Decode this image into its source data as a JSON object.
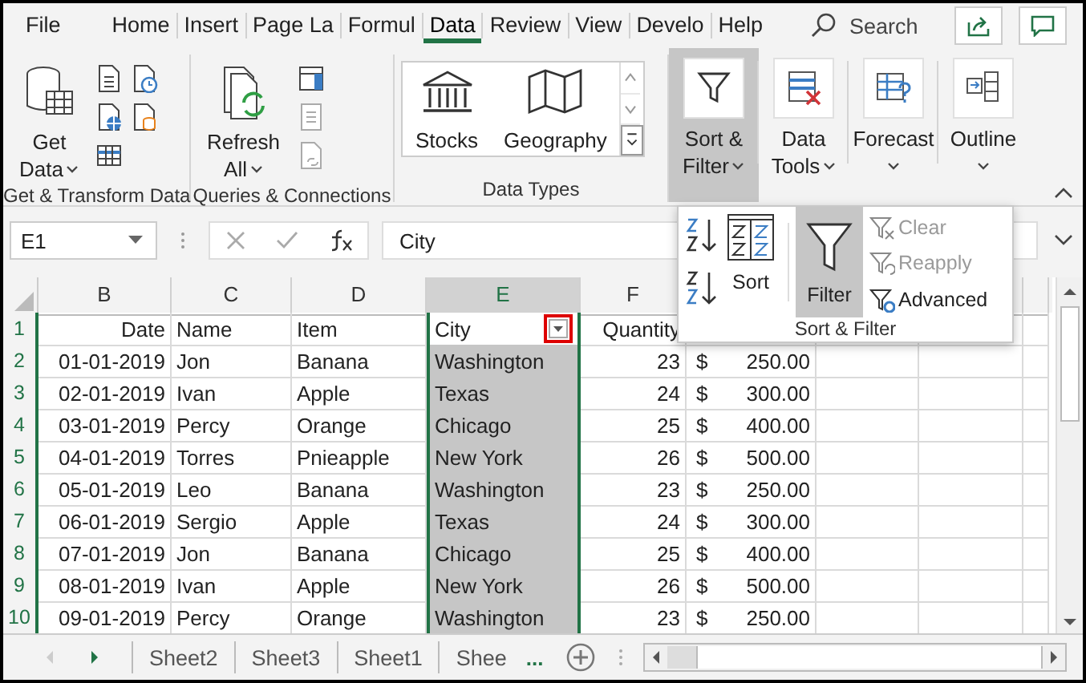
{
  "menu_tabs": [
    {
      "label": "File",
      "selected": false
    },
    {
      "label": "Home",
      "selected": false
    },
    {
      "label": "Insert",
      "selected": false
    },
    {
      "label": "Page La",
      "selected": false
    },
    {
      "label": "Formul",
      "selected": false
    },
    {
      "label": "Data",
      "selected": true
    },
    {
      "label": "Review",
      "selected": false
    },
    {
      "label": "View",
      "selected": false
    },
    {
      "label": "Develo",
      "selected": false
    },
    {
      "label": "Help",
      "selected": false
    }
  ],
  "search": {
    "placeholder": "Search"
  },
  "ribbon": {
    "groups": [
      {
        "kind": "get_data",
        "label": "Get & Transform Data",
        "button": {
          "lines": [
            "Get",
            "Data"
          ],
          "dropdown": true
        }
      },
      {
        "kind": "queries",
        "label": "Queries & Connections",
        "button": {
          "lines": [
            "Refresh",
            "All"
          ],
          "dropdown": true
        }
      },
      {
        "kind": "data_types",
        "label": "Data Types",
        "items": [
          "Stocks",
          "Geography"
        ]
      },
      {
        "kind": "filter",
        "button": {
          "lines": [
            "Sort &",
            "Filter"
          ],
          "dropdown": true,
          "selected": true
        }
      },
      {
        "kind": "data_tools",
        "button": {
          "lines": [
            "Data",
            "Tools"
          ],
          "dropdown": true,
          "selected": false
        }
      },
      {
        "kind": "forecast",
        "button": {
          "lines": [
            "Forecast"
          ],
          "dropdown": true,
          "selected": false
        }
      },
      {
        "kind": "outline",
        "button": {
          "lines": [
            "Outline"
          ],
          "dropdown": true,
          "selected": false
        }
      }
    ]
  },
  "formula_bar": {
    "name_box": "E1",
    "formula": "City"
  },
  "sheet": {
    "columns": [
      {
        "label": "B",
        "selected": false
      },
      {
        "label": "C",
        "selected": false
      },
      {
        "label": "D",
        "selected": false
      },
      {
        "label": "E",
        "selected": true
      },
      {
        "label": "F",
        "selected": false
      }
    ],
    "header_row": {
      "number": "1",
      "cells": [
        {
          "text": "Date",
          "filter_button": false
        },
        {
          "text": "Name",
          "filter_button": false
        },
        {
          "text": "Item",
          "filter_button": false
        },
        {
          "text": "City",
          "filter_button": true,
          "highlighted": true
        },
        {
          "text": "Quantity",
          "filter_button": false
        }
      ]
    },
    "rows": [
      {
        "number": "2",
        "cells": [
          "01-01-2019",
          "Jon",
          "Banana",
          "Washington",
          "23"
        ],
        "currency": "$",
        "amount": "250.00"
      },
      {
        "number": "3",
        "cells": [
          "02-01-2019",
          "Ivan",
          "Apple",
          "Texas",
          "24"
        ],
        "currency": "$",
        "amount": "300.00"
      },
      {
        "number": "4",
        "cells": [
          "03-01-2019",
          "Percy",
          "Orange",
          "Chicago",
          "25"
        ],
        "currency": "$",
        "amount": "400.00"
      },
      {
        "number": "5",
        "cells": [
          "04-01-2019",
          "Torres",
          "Pnieapple",
          "New York",
          "26"
        ],
        "currency": "$",
        "amount": "500.00"
      },
      {
        "number": "6",
        "cells": [
          "05-01-2019",
          "Leo",
          "Banana",
          "Washington",
          "23"
        ],
        "currency": "$",
        "amount": "250.00"
      },
      {
        "number": "7",
        "cells": [
          "06-01-2019",
          "Sergio",
          "Apple",
          "Texas",
          "24"
        ],
        "currency": "$",
        "amount": "300.00"
      },
      {
        "number": "8",
        "cells": [
          "07-01-2019",
          "Jon",
          "Banana",
          "Chicago",
          "25"
        ],
        "currency": "$",
        "amount": "400.00"
      },
      {
        "number": "9",
        "cells": [
          "08-01-2019",
          "Ivan",
          "Apple",
          "New York",
          "26"
        ],
        "currency": "$",
        "amount": "500.00"
      },
      {
        "number": "10",
        "cells": [
          "09-01-2019",
          "Percy",
          "Orange",
          "Washington",
          "23"
        ],
        "currency": "$",
        "amount": "250.00"
      }
    ]
  },
  "sort_filter_popup": {
    "sort_label": "Sort",
    "filter": {
      "label": "Filter",
      "selected": true
    },
    "commands": [
      {
        "label": "Clear",
        "disabled": true
      },
      {
        "label": "Reapply",
        "disabled": true
      },
      {
        "label": "Advanced",
        "disabled": false
      }
    ],
    "group_label": "Sort & Filter"
  },
  "sheet_tabs": {
    "tabs": [
      {
        "label": "Sheet2",
        "selected": false
      },
      {
        "label": "Sheet3",
        "selected": false
      },
      {
        "label": "Sheet1",
        "selected": false
      },
      {
        "label": "Shee",
        "selected": false
      }
    ],
    "more": "..."
  }
}
